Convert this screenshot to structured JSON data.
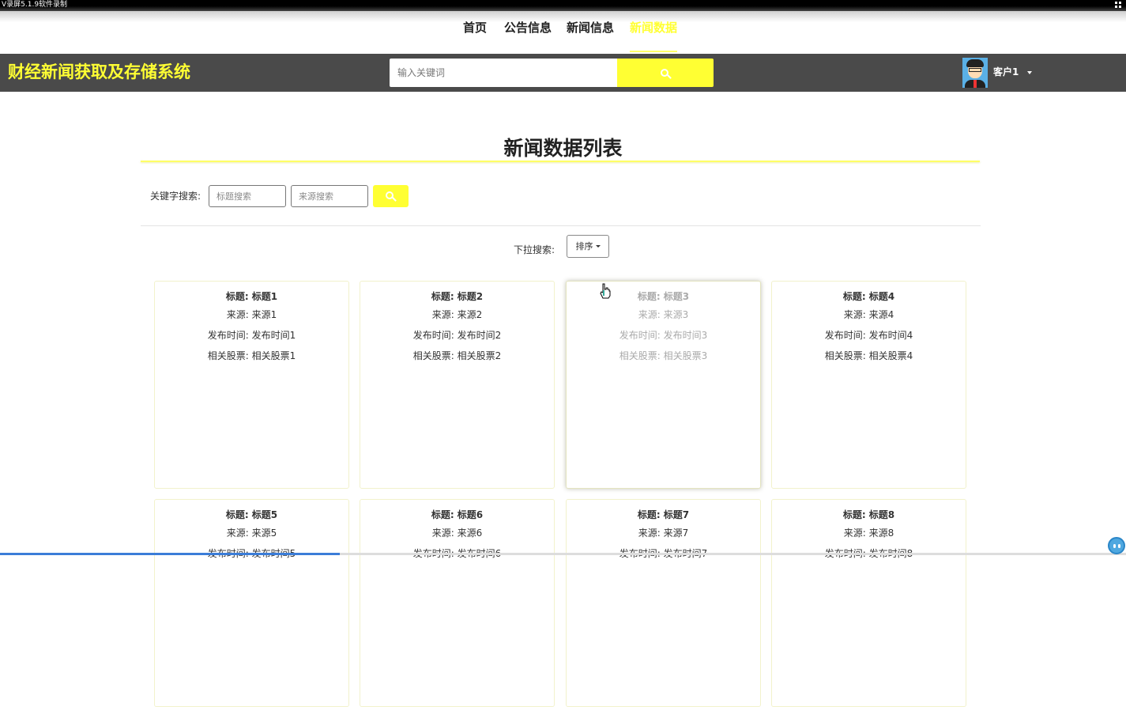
{
  "recorder": {
    "title": "V录屏5.1.9软件录制"
  },
  "nav": {
    "items": [
      {
        "label": "首页"
      },
      {
        "label": "公告信息"
      },
      {
        "label": "新闻信息"
      },
      {
        "label": "新闻数据"
      }
    ],
    "active_index": 3
  },
  "header": {
    "site_title": "财经新闻获取及存储系统",
    "search_placeholder": "输入关键词",
    "user_name": "客户1"
  },
  "page": {
    "title": "新闻数据列表",
    "keyword_label": "关键字搜索:",
    "title_search_placeholder": "标题搜索",
    "source_search_placeholder": "来源搜索",
    "dropdown_label": "下拉搜索:",
    "sort_label": "排序"
  },
  "cards": [
    {
      "title": "标题: 标题1",
      "source": "来源: 来源1",
      "time": "发布时间: 发布时间1",
      "stock": "相关股票: 相关股票1"
    },
    {
      "title": "标题: 标题2",
      "source": "来源: 来源2",
      "time": "发布时间: 发布时间2",
      "stock": "相关股票: 相关股票2"
    },
    {
      "title": "标题: 标题3",
      "source": "来源: 来源3",
      "time": "发布时间: 发布时间3",
      "stock": "相关股票: 相关股票3"
    },
    {
      "title": "标题: 标题4",
      "source": "来源: 来源4",
      "time": "发布时间: 发布时间4",
      "stock": "相关股票: 相关股票4"
    },
    {
      "title": "标题: 标题5",
      "source": "来源: 来源5",
      "time": "发布时间: 发布时间5",
      "stock": ""
    },
    {
      "title": "标题: 标题6",
      "source": "来源: 来源6",
      "time": "发布时间: 发布时间6",
      "stock": ""
    },
    {
      "title": "标题: 标题7",
      "source": "来源: 来源7",
      "time": "发布时间: 发布时间7",
      "stock": ""
    },
    {
      "title": "标题: 标题8",
      "source": "来源: 来源8",
      "time": "发布时间: 发布时间8",
      "stock": ""
    }
  ],
  "colors": {
    "accent": "#ffff33",
    "header_bg": "#4a4a4a"
  }
}
